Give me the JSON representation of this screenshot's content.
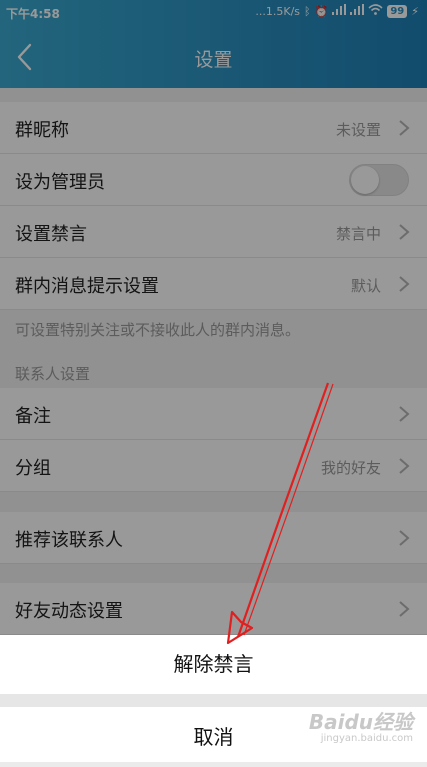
{
  "status_bar": {
    "time": "下午4:58",
    "network_speed": "...1.5K/s",
    "battery": "99"
  },
  "header": {
    "title": "设置"
  },
  "rows": [
    {
      "label": "群昵称",
      "value": "未设置"
    },
    {
      "label": "设为管理员",
      "toggle": "off"
    },
    {
      "label": "设置禁言",
      "value": "禁言中"
    },
    {
      "label": "群内消息提示设置",
      "value": "默认"
    }
  ],
  "group_note": "可设置特别关注或不接收此人的群内消息。",
  "contact_section": {
    "title": "联系人设置",
    "rows": [
      {
        "label": "备注",
        "value": ""
      },
      {
        "label": "分组",
        "value": "我的好友"
      }
    ]
  },
  "recommend_row": {
    "label": "推荐该联系人"
  },
  "moments_row": {
    "label": "好友动态设置"
  },
  "action_sheet": {
    "primary": "解除禁言",
    "cancel": "取消"
  },
  "watermark": {
    "brand": "Baidu经验",
    "sub": "jingyan.baidu.com"
  },
  "colors": {
    "header": "#2a8fc0",
    "annotation_arrow": "#e02020"
  }
}
